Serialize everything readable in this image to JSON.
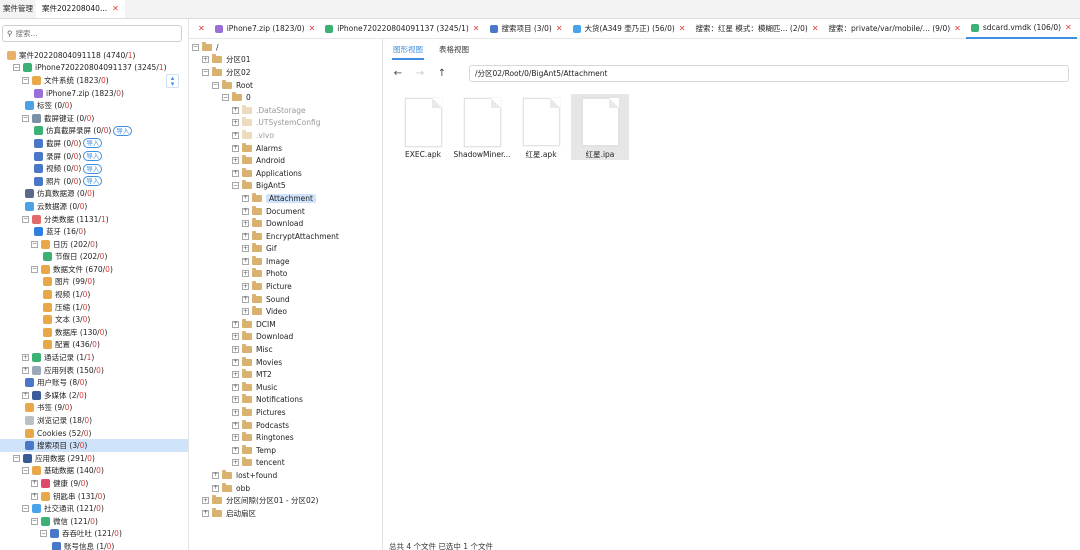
{
  "top_tabs": [
    {
      "label": "案件管理",
      "active": false
    },
    {
      "label": "案件202208040...",
      "active": true,
      "closable": true
    }
  ],
  "search": {
    "placeholder": "搜索..."
  },
  "left_tree": [
    {
      "indent": 0,
      "toggle": "",
      "icon": "case-folder-icon",
      "color": "#e8b06a",
      "label": "案件20220804091118",
      "count": "4740",
      "red": "1"
    },
    {
      "indent": 1,
      "toggle": "-",
      "icon": "phone-icon",
      "color": "#3bb273",
      "label": "iPhone720220804091137",
      "count": "3245",
      "red": "1"
    },
    {
      "indent": 2,
      "toggle": "-",
      "icon": "filesystem-icon",
      "color": "#e8a84a",
      "label": "文件系统",
      "count": "1823",
      "red": "0"
    },
    {
      "indent": 3,
      "toggle": "",
      "icon": "zip-icon",
      "color": "#9a6fd8",
      "label": "iPhone7.zip",
      "count": "1823",
      "red": "0"
    },
    {
      "indent": 2,
      "toggle": "",
      "icon": "tag-icon",
      "color": "#4aa3e8",
      "label": "标签",
      "count": "0",
      "red": "0"
    },
    {
      "indent": 2,
      "toggle": "-",
      "icon": "evidence-icon",
      "color": "#7a8fa8",
      "label": "截屏键证",
      "count": "0",
      "red": "0"
    },
    {
      "indent": 3,
      "toggle": "",
      "icon": "sim-screen-icon",
      "color": "#3bb273",
      "label": "仿真截屏录屏",
      "count": "0",
      "red": "0",
      "import": "导入"
    },
    {
      "indent": 3,
      "toggle": "",
      "icon": "screenshot-icon",
      "color": "#4a78c8",
      "label": "截屏",
      "count": "0",
      "red": "0",
      "import": "导入"
    },
    {
      "indent": 3,
      "toggle": "",
      "icon": "record-icon",
      "color": "#4a78c8",
      "label": "录屏",
      "count": "0",
      "red": "0",
      "import": "导入"
    },
    {
      "indent": 3,
      "toggle": "",
      "icon": "video-icon",
      "color": "#4a78c8",
      "label": "视频",
      "count": "0",
      "red": "0",
      "import": "导入"
    },
    {
      "indent": 3,
      "toggle": "",
      "icon": "photo-icon",
      "color": "#4a78c8",
      "label": "照片",
      "count": "0",
      "red": "0",
      "import": "导入"
    },
    {
      "indent": 2,
      "toggle": "",
      "icon": "sim-data-icon",
      "color": "#5a6b8a",
      "label": "仿真数据源",
      "count": "0",
      "red": "0"
    },
    {
      "indent": 2,
      "toggle": "",
      "icon": "cloud-icon",
      "color": "#4aa3e8",
      "label": "云数据源",
      "count": "0",
      "red": "0"
    },
    {
      "indent": 2,
      "toggle": "-",
      "icon": "category-icon",
      "color": "#e06a6a",
      "label": "分类数据",
      "count": "1131",
      "red": "1"
    },
    {
      "indent": 3,
      "toggle": "",
      "icon": "bluetooth-icon",
      "color": "#2f7fe0",
      "label": "蓝牙",
      "count": "16",
      "red": "0"
    },
    {
      "indent": 3,
      "toggle": "-",
      "icon": "calendar-icon",
      "color": "#e8a84a",
      "label": "日历",
      "count": "202",
      "red": "0"
    },
    {
      "indent": 4,
      "toggle": "",
      "icon": "holiday-icon",
      "color": "#3bb273",
      "label": "节假日",
      "count": "202",
      "red": "0"
    },
    {
      "indent": 3,
      "toggle": "-",
      "icon": "data-file-icon",
      "color": "#e8a84a",
      "label": "数据文件",
      "count": "670",
      "red": "0"
    },
    {
      "indent": 4,
      "toggle": "",
      "icon": "image-file-icon",
      "color": "#e8a84a",
      "label": "图片",
      "count": "99",
      "red": "0"
    },
    {
      "indent": 4,
      "toggle": "",
      "icon": "video-file-icon",
      "color": "#e8a84a",
      "label": "视频",
      "count": "1",
      "red": "0"
    },
    {
      "indent": 4,
      "toggle": "",
      "icon": "archive-icon",
      "color": "#e8a84a",
      "label": "压缩",
      "count": "1",
      "red": "0"
    },
    {
      "indent": 4,
      "toggle": "",
      "icon": "text-file-icon",
      "color": "#e8a84a",
      "label": "文本",
      "count": "3",
      "red": "0"
    },
    {
      "indent": 4,
      "toggle": "",
      "icon": "database-icon",
      "color": "#e8a84a",
      "label": "数据库",
      "count": "130",
      "red": "0"
    },
    {
      "indent": 4,
      "toggle": "",
      "icon": "config-icon",
      "color": "#e8a84a",
      "label": "配置",
      "count": "436",
      "red": "0"
    },
    {
      "indent": 2,
      "toggle": "+",
      "icon": "call-log-icon",
      "color": "#3bb273",
      "label": "通话记录",
      "count": "1",
      "red": "1"
    },
    {
      "indent": 2,
      "toggle": "+",
      "icon": "app-list-icon",
      "color": "#9aa8b8",
      "label": "应用列表",
      "count": "150",
      "red": "0"
    },
    {
      "indent": 2,
      "toggle": "",
      "icon": "account-icon",
      "color": "#4a78c8",
      "label": "用户账号",
      "count": "8",
      "red": "0"
    },
    {
      "indent": 2,
      "toggle": "+",
      "icon": "media-icon",
      "color": "#3a5a98",
      "label": "多媒体",
      "count": "2",
      "red": "0"
    },
    {
      "indent": 2,
      "toggle": "",
      "icon": "bookmark-icon",
      "color": "#e8a84a",
      "label": "书签",
      "count": "9",
      "red": "0"
    },
    {
      "indent": 2,
      "toggle": "",
      "icon": "browse-history-icon",
      "color": "#b8c0c8",
      "label": "浏览记录",
      "count": "18",
      "red": "0"
    },
    {
      "indent": 2,
      "toggle": "",
      "icon": "cookie-icon",
      "color": "#e8a84a",
      "label": "Cookies",
      "count": "52",
      "red": "0"
    },
    {
      "indent": 2,
      "toggle": "",
      "icon": "search-items-icon",
      "color": "#4a78c8",
      "label": "搜索项目",
      "count": "3",
      "red": "0",
      "selected": true
    },
    {
      "indent": 1,
      "toggle": "-",
      "icon": "app-data-icon",
      "color": "#3a5a98",
      "label": "应用数据",
      "count": "291",
      "red": "0"
    },
    {
      "indent": 2,
      "toggle": "-",
      "icon": "basic-data-icon",
      "color": "#e8a84a",
      "label": "基础数据",
      "count": "140",
      "red": "0"
    },
    {
      "indent": 3,
      "toggle": "+",
      "icon": "health-icon",
      "color": "#e04a6a",
      "label": "健康",
      "count": "9",
      "red": "0"
    },
    {
      "indent": 3,
      "toggle": "+",
      "icon": "keychain-icon",
      "color": "#e8a84a",
      "label": "钥匙串",
      "count": "131",
      "red": "0"
    },
    {
      "indent": 2,
      "toggle": "-",
      "icon": "social-icon",
      "color": "#4aa3e8",
      "label": "社交通讯",
      "count": "121",
      "red": "0"
    },
    {
      "indent": 3,
      "toggle": "-",
      "icon": "wechat-icon",
      "color": "#3bb273",
      "label": "微信",
      "count": "121",
      "red": "0"
    },
    {
      "indent": 4,
      "toggle": "-",
      "icon": "user-icon",
      "color": "#4a78c8",
      "label": "吞吞吐吐",
      "count": "121",
      "red": "0"
    },
    {
      "indent": 5,
      "toggle": "",
      "icon": "account-info-icon",
      "color": "#4a78c8",
      "label": "账号信息",
      "count": "1",
      "red": "0"
    }
  ],
  "doc_tabs": [
    {
      "label": "",
      "icon": "",
      "color": "",
      "closable": true
    },
    {
      "label": "iPhone7.zip (1823/0)",
      "icon": "zip-icon",
      "color": "#9a6fd8",
      "closable": true
    },
    {
      "label": "iPhone720220804091137 (3245/1)",
      "icon": "phone-icon",
      "color": "#3bb273",
      "closable": true
    },
    {
      "label": "搜索项目 (3/0)",
      "icon": "search-items-icon",
      "color": "#4a78c8",
      "closable": true
    },
    {
      "label": "大货(A349 壶乃正) (56/0)",
      "icon": "chat-icon",
      "color": "#4aa3e8",
      "closable": true
    },
    {
      "label": "搜索：红星 模式：模糊匹... (2/0)",
      "icon": "",
      "color": "",
      "closable": true
    },
    {
      "label": "搜索：private/var/mobile/... (9/0)",
      "icon": "",
      "color": "",
      "closable": true
    },
    {
      "label": "sdcard.vmdk (106/0)",
      "icon": "disk-icon",
      "color": "#3bb273",
      "closable": true,
      "active": true
    },
    {
      "label": "<",
      "icon": "",
      "color": "",
      "closable": false
    }
  ],
  "mid_tree": [
    {
      "indent": 0,
      "toggle": "-",
      "label": "/",
      "pale": false
    },
    {
      "indent": 1,
      "toggle": "+",
      "label": "分区01",
      "pale": false
    },
    {
      "indent": 1,
      "toggle": "-",
      "label": "分区02",
      "pale": false
    },
    {
      "indent": 2,
      "toggle": "-",
      "label": "Root",
      "pale": false
    },
    {
      "indent": 3,
      "toggle": "-",
      "label": "0",
      "pale": false
    },
    {
      "indent": 4,
      "toggle": "+",
      "label": ".DataStorage",
      "pale": true
    },
    {
      "indent": 4,
      "toggle": "+",
      "label": ".UTSystemConfig",
      "pale": true
    },
    {
      "indent": 4,
      "toggle": "+",
      "label": ".vivo",
      "pale": true
    },
    {
      "indent": 4,
      "toggle": "+",
      "label": "Alarms",
      "pale": false
    },
    {
      "indent": 4,
      "toggle": "+",
      "label": "Android",
      "pale": false
    },
    {
      "indent": 4,
      "toggle": "+",
      "label": "Applications",
      "pale": false
    },
    {
      "indent": 4,
      "toggle": "-",
      "label": "BigAnt5",
      "pale": false
    },
    {
      "indent": 5,
      "toggle": "+",
      "label": "Attachment",
      "pale": false,
      "selected": true
    },
    {
      "indent": 5,
      "toggle": "+",
      "label": "Document",
      "pale": false
    },
    {
      "indent": 5,
      "toggle": "+",
      "label": "Download",
      "pale": false
    },
    {
      "indent": 5,
      "toggle": "+",
      "label": "EncryptAttachment",
      "pale": false
    },
    {
      "indent": 5,
      "toggle": "+",
      "label": "Gif",
      "pale": false
    },
    {
      "indent": 5,
      "toggle": "+",
      "label": "Image",
      "pale": false
    },
    {
      "indent": 5,
      "toggle": "+",
      "label": "Photo",
      "pale": false
    },
    {
      "indent": 5,
      "toggle": "+",
      "label": "Picture",
      "pale": false
    },
    {
      "indent": 5,
      "toggle": "+",
      "label": "Sound",
      "pale": false
    },
    {
      "indent": 5,
      "toggle": "+",
      "label": "Video",
      "pale": false
    },
    {
      "indent": 4,
      "toggle": "+",
      "label": "DCIM",
      "pale": false
    },
    {
      "indent": 4,
      "toggle": "+",
      "label": "Download",
      "pale": false
    },
    {
      "indent": 4,
      "toggle": "+",
      "label": "Misc",
      "pale": false
    },
    {
      "indent": 4,
      "toggle": "+",
      "label": "Movies",
      "pale": false
    },
    {
      "indent": 4,
      "toggle": "+",
      "label": "MT2",
      "pale": false
    },
    {
      "indent": 4,
      "toggle": "+",
      "label": "Music",
      "pale": false
    },
    {
      "indent": 4,
      "toggle": "+",
      "label": "Notifications",
      "pale": false
    },
    {
      "indent": 4,
      "toggle": "+",
      "label": "Pictures",
      "pale": false
    },
    {
      "indent": 4,
      "toggle": "+",
      "label": "Podcasts",
      "pale": false
    },
    {
      "indent": 4,
      "toggle": "+",
      "label": "Ringtones",
      "pale": false
    },
    {
      "indent": 4,
      "toggle": "+",
      "label": "Temp",
      "pale": false
    },
    {
      "indent": 4,
      "toggle": "+",
      "label": "tencent",
      "pale": false
    },
    {
      "indent": 2,
      "toggle": "+",
      "label": "lost+found",
      "pale": false
    },
    {
      "indent": 2,
      "toggle": "+",
      "label": "obb",
      "pale": false
    },
    {
      "indent": 1,
      "toggle": "+",
      "label": "分区间隙(分区01 - 分区02)",
      "pale": false
    },
    {
      "indent": 1,
      "toggle": "+",
      "label": "启动扇区",
      "pale": false
    }
  ],
  "view_tabs": [
    {
      "label": "图形视图",
      "active": true
    },
    {
      "label": "表格视图",
      "active": false
    }
  ],
  "nav": {
    "back": "←",
    "forward": "→",
    "up": "↑",
    "path": "/分区02/Root/0/BigAnt5/Attachment"
  },
  "files": [
    {
      "name": "EXEC.apk",
      "selected": false
    },
    {
      "name": "ShadowMiner...",
      "selected": false
    },
    {
      "name": "红星.apk",
      "selected": false
    },
    {
      "name": "红星.ipa",
      "selected": true
    }
  ],
  "status": "总共 4 个文件   已选中 1 个文件"
}
